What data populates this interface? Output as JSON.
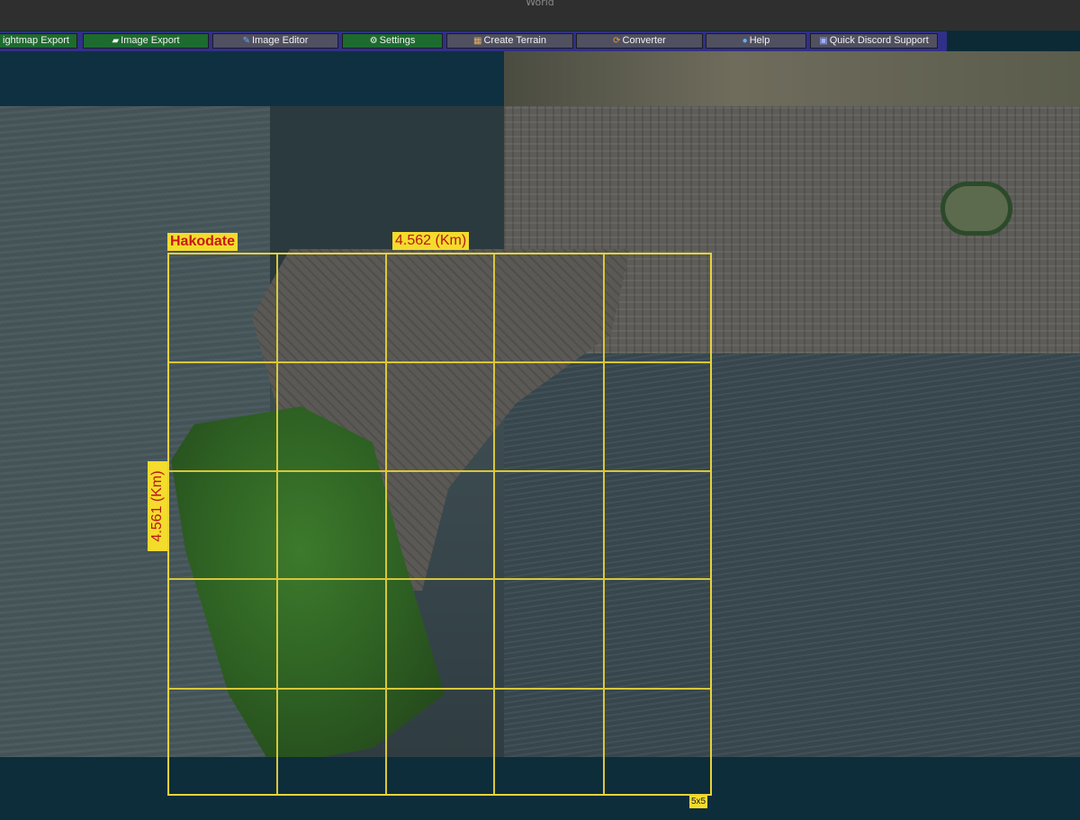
{
  "window": {
    "title": "World"
  },
  "toolbar": {
    "buttons": [
      {
        "label": "ightmap Export",
        "icon": ""
      },
      {
        "label": "Image Export",
        "icon": "landscape-icon"
      },
      {
        "label": "Image Editor",
        "icon": "pencil-icon"
      },
      {
        "label": "Settings",
        "icon": "gear-icon"
      },
      {
        "label": "Create Terrain",
        "icon": "terrain-icon"
      },
      {
        "label": "Converter",
        "icon": "converter-icon"
      },
      {
        "label": "Help",
        "icon": "help-icon"
      },
      {
        "label": "Quick Discord Support",
        "icon": "discord-icon"
      }
    ]
  },
  "map": {
    "area_name": "Hakodate",
    "width_label": "4.562 (Km)",
    "height_label": "4.561 (Km)",
    "grid_size_label": "5x5"
  },
  "colors": {
    "toolbar_bg": "#30308a",
    "button_green": "#1d6b2e",
    "button_gray": "#505060",
    "grid_line": "#e8d33a",
    "label_bg": "#f4dc2c",
    "label_text": "#c81818"
  }
}
